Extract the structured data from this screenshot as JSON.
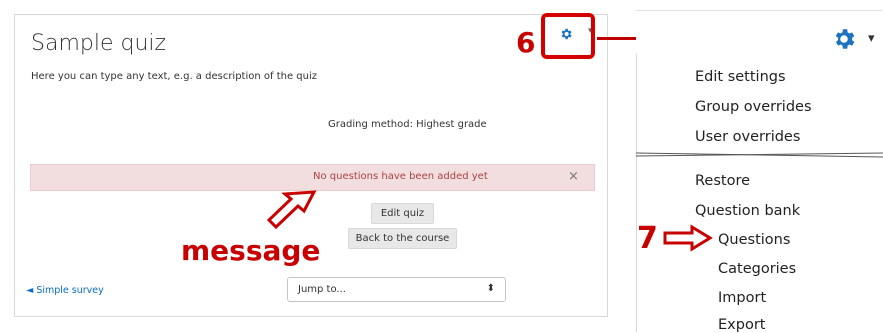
{
  "quiz": {
    "title": "Sample quiz",
    "description": "Here you can type any text, e.g. a description of the quiz",
    "grading": "Grading method: Highest grade",
    "alert": "No questions have been added yet",
    "alert_close": "×",
    "edit_button": "Edit quiz",
    "back_button": "Back to the course",
    "prev_link": "◄ Simple survey",
    "jump_placeholder": "Jump to...",
    "jump_caret": "⬍"
  },
  "annotations": {
    "step6": "6",
    "step7": "7",
    "message": "message"
  },
  "menu": {
    "items": [
      "Edit settings",
      "Group overrides",
      "User overrides",
      "Restore",
      "Question bank",
      "Questions",
      "Categories",
      "Import",
      "Export"
    ]
  },
  "colors": {
    "accent_red": "#c80000",
    "gear_blue": "#1e73be",
    "link_blue": "#0a6cc8",
    "alert_bg": "#f2dede"
  }
}
